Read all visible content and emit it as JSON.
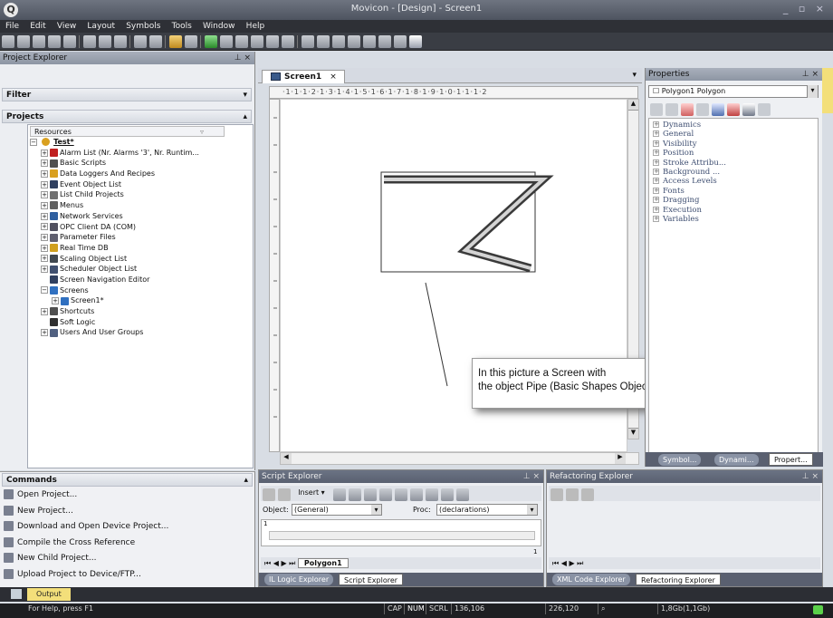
{
  "titlebar": {
    "title": "Movicon - [Design] - Screen1"
  },
  "menu": [
    "File",
    "Edit",
    "View",
    "Layout",
    "Symbols",
    "Tools",
    "Window",
    "Help"
  ],
  "project_explorer": {
    "title": "Project Explorer",
    "filter_label": "Filter",
    "projects_label": "Projects",
    "resources_label": "Resources",
    "root": "Test*",
    "items": [
      {
        "label": "Alarm List (Nr. Alarms '3', Nr. Runtim...",
        "expander": "+",
        "color": "#c02020"
      },
      {
        "label": "Basic Scripts",
        "expander": "+",
        "color": "#505050"
      },
      {
        "label": "Data Loggers And Recipes",
        "expander": "+",
        "color": "#d9a020"
      },
      {
        "label": "Event Object List",
        "expander": "+",
        "color": "#304060"
      },
      {
        "label": "List Child Projects",
        "expander": "+",
        "color": "#707070"
      },
      {
        "label": "Menus",
        "expander": "+",
        "color": "#606060"
      },
      {
        "label": "Network Services",
        "expander": "+",
        "color": "#3060a0"
      },
      {
        "label": "OPC Client DA (COM)",
        "expander": "+",
        "color": "#505060"
      },
      {
        "label": "Parameter Files",
        "expander": "+",
        "color": "#606070"
      },
      {
        "label": "Real Time DB",
        "expander": "+",
        "color": "#d0a020"
      },
      {
        "label": "Scaling Object List",
        "expander": "+",
        "color": "#404850"
      },
      {
        "label": "Scheduler Object List",
        "expander": "+",
        "color": "#405070"
      },
      {
        "label": "Screen Navigation Editor",
        "expander": "",
        "color": "#304060"
      },
      {
        "label": "Screens",
        "expander": "−",
        "color": "#3070c0"
      },
      {
        "label": "Screen1*",
        "expander": "+",
        "color": "#3070c0",
        "indent": 1
      },
      {
        "label": "Shortcuts",
        "expander": "+",
        "color": "#505050"
      },
      {
        "label": "Soft Logic",
        "expander": "",
        "color": "#303030"
      },
      {
        "label": "Users And User Groups",
        "expander": "+",
        "color": "#506080"
      }
    ]
  },
  "commands": {
    "title": "Commands",
    "items": [
      "Open Project...",
      "New Project...",
      "Download and Open Device Project...",
      "Compile the Cross Reference",
      "New Child Project...",
      "Upload Project to Device/FTP..."
    ]
  },
  "editor": {
    "tab_label": "Screen1",
    "ruler_text": "·1·1·1·2·1·3·1·4·1·5·1·6·1·7·1·8·1·9·1·0·1·1·1·2",
    "callout": [
      "In this picture a Screen with",
      "the object Pipe (Basic Shapes Object)"
    ]
  },
  "properties": {
    "title": "Properties",
    "selector_value": "Polygon1 Polygon",
    "groups": [
      "Dynamics",
      "General",
      "Visibility",
      "Position",
      "Stroke Attribu...",
      "Background ...",
      "Access Levels",
      "Fonts",
      "Dragging",
      "Execution",
      "Variables"
    ],
    "tabs": [
      "Symbol...",
      "Dynami...",
      "Propert..."
    ]
  },
  "script_explorer": {
    "title": "Script Explorer",
    "insert_label": "Insert",
    "object_label": "Object:",
    "object_value": "(General)",
    "proc_label": "Proc:",
    "proc_value": "(declarations)",
    "line_number": "1",
    "col_number": "1",
    "sheet_tab": "Polygon1",
    "bottom_tabs": [
      "IL Logic Explorer",
      "Script Explorer"
    ]
  },
  "refactoring_explorer": {
    "title": "Refactoring Explorer",
    "bottom_tabs": [
      "XML Code Explorer",
      "Refactoring Explorer"
    ]
  },
  "output_tab": "Output",
  "statusbar": {
    "help": "For Help, press F1",
    "cap": "CAP",
    "num": "NUM",
    "scrl": "SCRL",
    "pos1": "136,106",
    "pos2": "226,120",
    "mem": "1,8Gb(1,1Gb)"
  }
}
